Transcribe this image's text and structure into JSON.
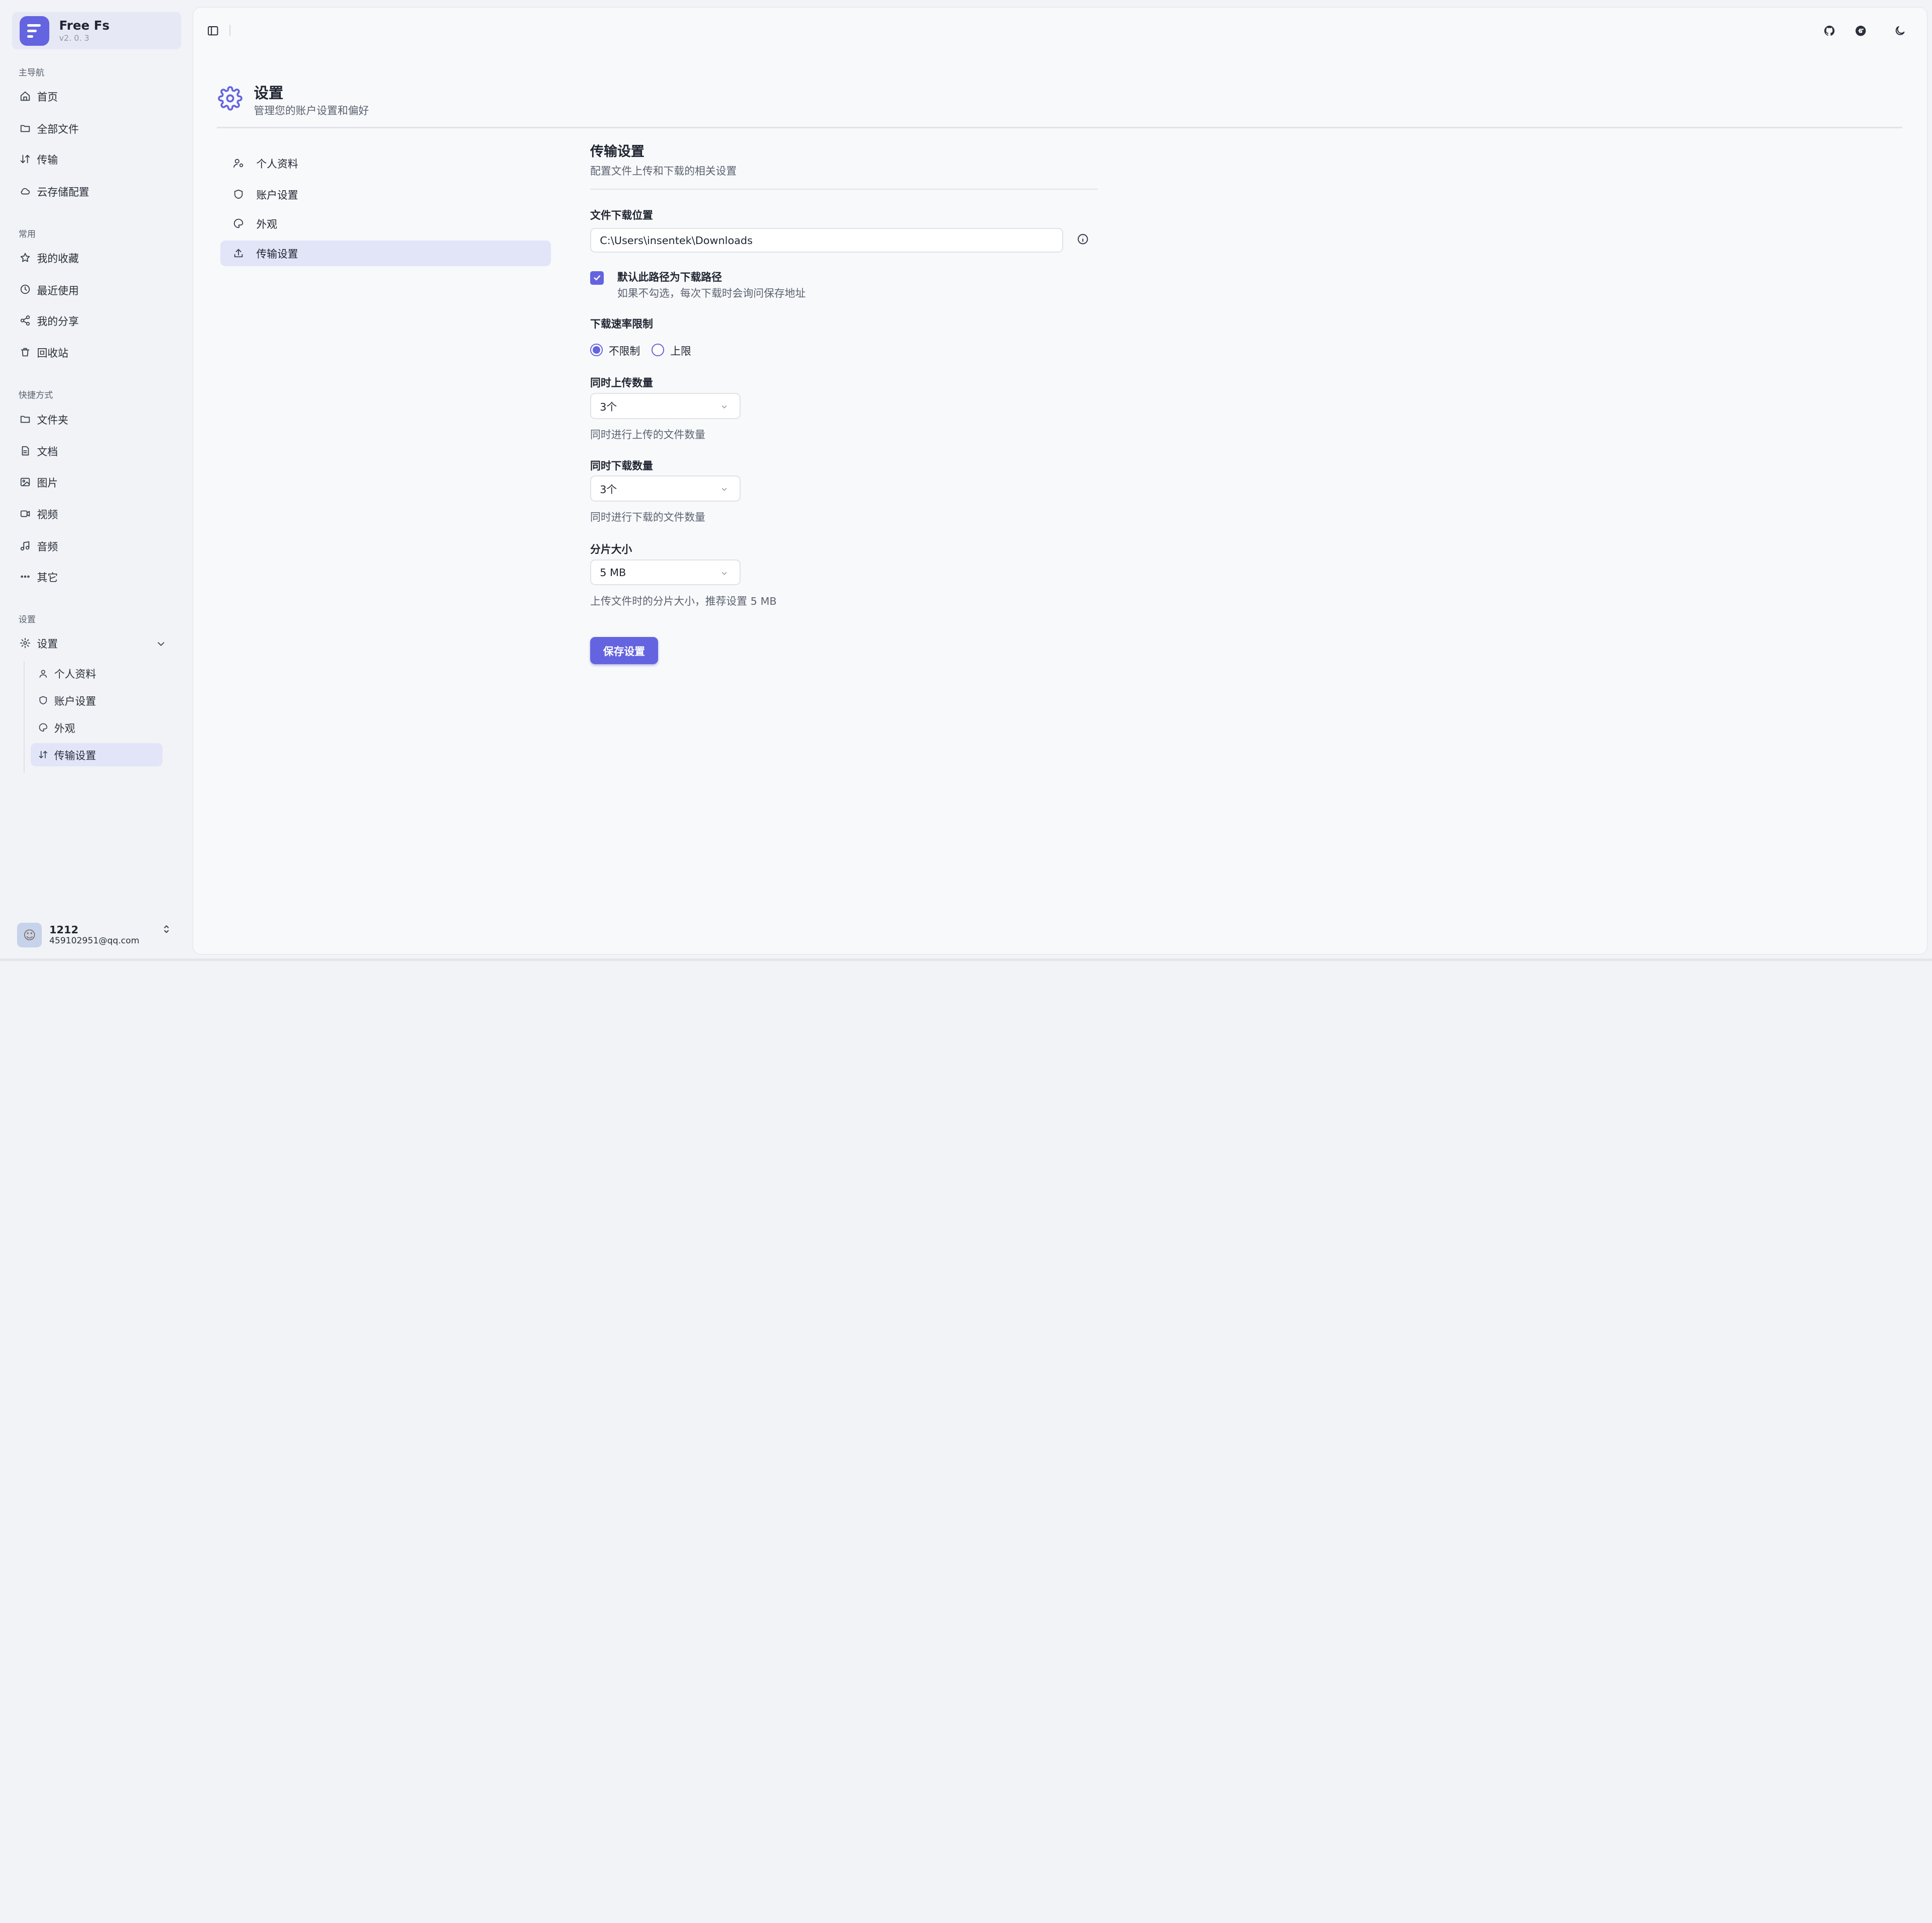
{
  "brand": {
    "name": "Free Fs",
    "version": "v2. 0. 3"
  },
  "sidebar": {
    "main_label": "主导航",
    "main_items": [
      {
        "label": "首页",
        "icon": "home-icon"
      },
      {
        "label": "全部文件",
        "icon": "folder-open-icon"
      },
      {
        "label": "传输",
        "icon": "transfer-icon"
      },
      {
        "label": "云存储配置",
        "icon": "cloud-icon"
      }
    ],
    "common_label": "常用",
    "common_items": [
      {
        "label": "我的收藏",
        "icon": "star-icon"
      },
      {
        "label": "最近使用",
        "icon": "clock-icon"
      },
      {
        "label": "我的分享",
        "icon": "share-icon"
      },
      {
        "label": "回收站",
        "icon": "trash-icon"
      }
    ],
    "shortcut_label": "快捷方式",
    "shortcut_items": [
      {
        "label": "文件夹",
        "icon": "folder-icon"
      },
      {
        "label": "文档",
        "icon": "document-icon"
      },
      {
        "label": "图片",
        "icon": "image-icon"
      },
      {
        "label": "视频",
        "icon": "video-icon"
      },
      {
        "label": "音频",
        "icon": "music-icon"
      },
      {
        "label": "其它",
        "icon": "more-icon"
      }
    ],
    "settings_label": "设置",
    "settings_group": "设置",
    "settings_sub": [
      {
        "label": "个人资料"
      },
      {
        "label": "账户设置"
      },
      {
        "label": "外观"
      },
      {
        "label": "传输设置"
      }
    ]
  },
  "user": {
    "name": "1212",
    "email": "459102951@qq.com"
  },
  "page": {
    "title": "设置",
    "subtitle": "管理您的账户设置和偏好"
  },
  "settings_nav": [
    {
      "label": "个人资料"
    },
    {
      "label": "账户设置"
    },
    {
      "label": "外观"
    },
    {
      "label": "传输设置"
    }
  ],
  "transfer": {
    "title": "传输设置",
    "subtitle": "配置文件上传和下载的相关设置",
    "download_location_label": "文件下载位置",
    "download_location_value": "C:\\Users\\insentek\\Downloads",
    "default_path_label": "默认此路径为下载路径",
    "default_path_hint": "如果不勾选，每次下载时会询问保存地址",
    "default_path_checked": true,
    "rate_limit_label": "下载速率限制",
    "rate_unlimited": "不限制",
    "rate_limit": "上限",
    "upload_count_label": "同时上传数量",
    "upload_count_value": "3个",
    "upload_count_hint": "同时进行上传的文件数量",
    "download_count_label": "同时下载数量",
    "download_count_value": "3个",
    "download_count_hint": "同时进行下载的文件数量",
    "chunk_label": "分片大小",
    "chunk_value": "5 MB",
    "chunk_hint": "上传文件时的分片大小，推荐设置 5 MB",
    "save_label": "保存设置"
  },
  "colors": {
    "accent": "#6464e0",
    "active_bg": "#e2e5f8"
  }
}
